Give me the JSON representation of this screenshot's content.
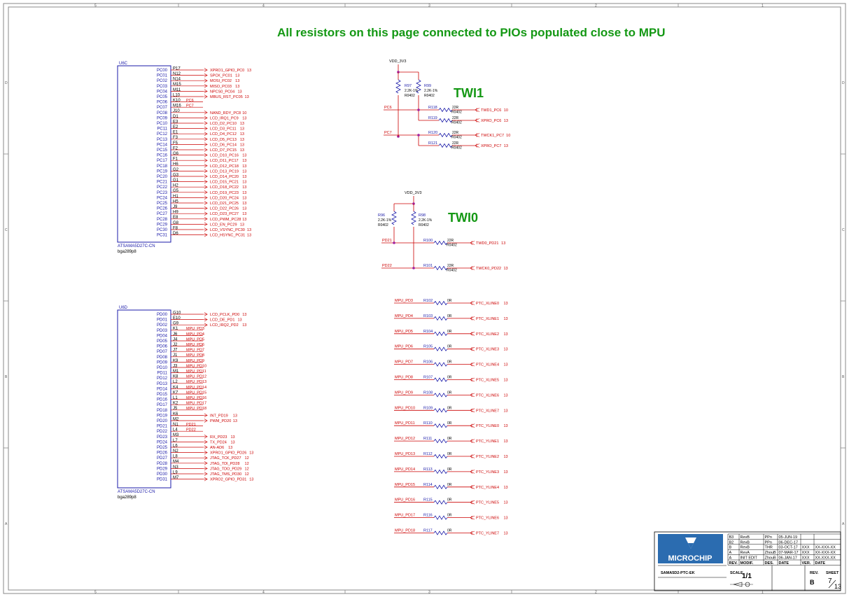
{
  "title": "All resistors  on this page connected to PIOs populated close to MPU",
  "zones_top": [
    "5",
    "4",
    "3",
    "2",
    "1"
  ],
  "zones_side": [
    "D",
    "C",
    "B",
    "A"
  ],
  "u6c": {
    "ref": "U6C",
    "part": "ATSAMA5D27C-CN",
    "package": "bga289p8",
    "pins": [
      {
        "pin": "PC00",
        "ball": "P17",
        "net": "XPRO1_GPIO_PC0",
        "page": "13"
      },
      {
        "pin": "PC01",
        "ball": "N12",
        "net": "SPCK_PC01",
        "page": "13"
      },
      {
        "pin": "PC02",
        "ball": "N14",
        "net": "MOSI_PC02",
        "page": "13"
      },
      {
        "pin": "PC03",
        "ball": "M15",
        "net": "MISO_PC03",
        "page": "13"
      },
      {
        "pin": "PC04",
        "ball": "M11",
        "net": "NPCS0_PC04",
        "page": "13"
      },
      {
        "pin": "PC05",
        "ball": "L10",
        "net": "MBUS_RST_PC05",
        "page": "13"
      },
      {
        "pin": "PC06",
        "ball": "K10",
        "net": "PC6",
        "page": ""
      },
      {
        "pin": "PC07",
        "ball": "M16",
        "net": "PC7",
        "page": ""
      },
      {
        "pin": "PC08",
        "ball": "J10",
        "net": "NAND_RDY_PC8",
        "page": "10"
      },
      {
        "pin": "PC09",
        "ball": "D1",
        "net": "LCD_IRQ1_PC9",
        "page": "13"
      },
      {
        "pin": "PC10",
        "ball": "E3",
        "net": "LCD_D2_PC10",
        "page": "13"
      },
      {
        "pin": "PC11",
        "ball": "E2",
        "net": "LCD_D3_PC11",
        "page": "13"
      },
      {
        "pin": "PC12",
        "ball": "E1",
        "net": "LCD_D4_PC12",
        "page": "13"
      },
      {
        "pin": "PC13",
        "ball": "F3",
        "net": "LCD_D5_PC13",
        "page": "13"
      },
      {
        "pin": "PC14",
        "ball": "F5",
        "net": "LCD_D6_PC14",
        "page": "13"
      },
      {
        "pin": "PC15",
        "ball": "F2",
        "net": "LCD_D7_PC15",
        "page": "13"
      },
      {
        "pin": "PC16",
        "ball": "G6",
        "net": "LCD_D10_PC16",
        "page": "13"
      },
      {
        "pin": "PC17",
        "ball": "F1",
        "net": "LCD_D11_PC17",
        "page": "13"
      },
      {
        "pin": "PC18",
        "ball": "H6",
        "net": "LCD_D12_PC18",
        "page": "13"
      },
      {
        "pin": "PC19",
        "ball": "G2",
        "net": "LCD_D13_PC19",
        "page": "13"
      },
      {
        "pin": "PC20",
        "ball": "G3",
        "net": "LCD_D14_PC20",
        "page": "13"
      },
      {
        "pin": "PC21",
        "ball": "G1",
        "net": "LCD_D15_PC21",
        "page": "13"
      },
      {
        "pin": "PC22",
        "ball": "H2",
        "net": "LCD_D18_PC22",
        "page": "13"
      },
      {
        "pin": "PC23",
        "ball": "G5",
        "net": "LCD_D19_PC23",
        "page": "13"
      },
      {
        "pin": "PC24",
        "ball": "H1",
        "net": "LCD_D20_PC24",
        "page": "13"
      },
      {
        "pin": "PC25",
        "ball": "H5",
        "net": "LCD_D21_PC25",
        "page": "13"
      },
      {
        "pin": "PC26",
        "ball": "J9",
        "net": "LCD_D22_PC26",
        "page": "13"
      },
      {
        "pin": "PC27",
        "ball": "H9",
        "net": "LCD_D23_PC27",
        "page": "13"
      },
      {
        "pin": "PC28",
        "ball": "E8",
        "net": "LCD_PWM_PC28",
        "page": "13"
      },
      {
        "pin": "PC29",
        "ball": "G8",
        "net": "LCD_EN_PC29",
        "page": "13"
      },
      {
        "pin": "PC30",
        "ball": "F8",
        "net": "LCD_VSYNC_PC30",
        "page": "13"
      },
      {
        "pin": "PC31",
        "ball": "D6",
        "net": "LCD_HSYNC_PC31",
        "page": "13"
      }
    ]
  },
  "u6d": {
    "ref": "U6D",
    "part": "ATSAMA5D27C-CN",
    "package": "bga289p8",
    "pins": [
      {
        "pin": "PD00",
        "ball": "G10",
        "net": "LCD_PCLK_PD0",
        "page": "13"
      },
      {
        "pin": "PD01",
        "ball": "E10",
        "net": "LCD_DE_PD1",
        "page": "13"
      },
      {
        "pin": "PD02",
        "ball": "G9",
        "net": "LCD_IRQ2_PD2",
        "page": "13"
      },
      {
        "pin": "PD03",
        "ball": "K1",
        "net": "MPU_PD3",
        "page": ""
      },
      {
        "pin": "PD04",
        "ball": "J6",
        "net": "MPU_PD4",
        "page": ""
      },
      {
        "pin": "PD05",
        "ball": "J4",
        "net": "MPU_PD5",
        "page": ""
      },
      {
        "pin": "PD06",
        "ball": "J2",
        "net": "MPU_PD6",
        "page": ""
      },
      {
        "pin": "PD07",
        "ball": "J7",
        "net": "MPU_PD7",
        "page": ""
      },
      {
        "pin": "PD08",
        "ball": "J1",
        "net": "MPU_PD8",
        "page": ""
      },
      {
        "pin": "PD09",
        "ball": "K9",
        "net": "MPU_PD9",
        "page": ""
      },
      {
        "pin": "PD10",
        "ball": "J3",
        "net": "MPU_PD10",
        "page": ""
      },
      {
        "pin": "PD11",
        "ball": "M1",
        "net": "MPU_PD11",
        "page": ""
      },
      {
        "pin": "PD12",
        "ball": "K8",
        "net": "MPU_PD12",
        "page": ""
      },
      {
        "pin": "PD13",
        "ball": "L2",
        "net": "MPU_PD13",
        "page": ""
      },
      {
        "pin": "PD14",
        "ball": "K4",
        "net": "MPU_PD14",
        "page": ""
      },
      {
        "pin": "PD15",
        "ball": "K7",
        "net": "MPU_PD15",
        "page": ""
      },
      {
        "pin": "PD16",
        "ball": "L1",
        "net": "MPU_PD16",
        "page": ""
      },
      {
        "pin": "PD17",
        "ball": "K2",
        "net": "MPU_PD17",
        "page": ""
      },
      {
        "pin": "PD18",
        "ball": "J5",
        "net": "MPU_PD18",
        "page": ""
      },
      {
        "pin": "PD19",
        "ball": "K6",
        "net": "INT_PD19",
        "page": "13"
      },
      {
        "pin": "PD20",
        "ball": "M2",
        "net": "PWM_PD20",
        "page": "13"
      },
      {
        "pin": "PD21",
        "ball": "N1",
        "net": "PD21",
        "page": ""
      },
      {
        "pin": "PD22",
        "ball": "L4",
        "net": "PD22",
        "page": ""
      },
      {
        "pin": "PD23",
        "ball": "M3",
        "net": "RX_PD23",
        "page": "13"
      },
      {
        "pin": "PD24",
        "ball": "L7",
        "net": "TX_PD24",
        "page": "13"
      },
      {
        "pin": "PD25",
        "ball": "L6",
        "net": "AN-AD6",
        "page": "13"
      },
      {
        "pin": "PD26",
        "ball": "N2",
        "net": "XPRO1_GPIO_PD26",
        "page": "13"
      },
      {
        "pin": "PD27",
        "ball": "L8",
        "net": "JTAG_TCK_PD27",
        "page": "12"
      },
      {
        "pin": "PD28",
        "ball": "M4",
        "net": "JTAG_TDI_PD28",
        "page": "12"
      },
      {
        "pin": "PD29",
        "ball": "N3",
        "net": "JTAG_TDO_PD29",
        "page": "12"
      },
      {
        "pin": "PD30",
        "ball": "L9",
        "net": "JTAG_TMS_PD30",
        "page": "12"
      },
      {
        "pin": "PD31",
        "ball": "M7",
        "net": "XPRO2_GPIO_PD31",
        "page": "13"
      }
    ]
  },
  "twi1": {
    "label": "TWI1",
    "supply": "VDD_3V3",
    "pullups": [
      {
        "ref": "R97",
        "value": "2.2K-1%",
        "pkg": "R0402"
      },
      {
        "ref": "R99",
        "value": "2.2K-1%",
        "pkg": "R0402"
      }
    ],
    "lines": [
      {
        "net_in": "PC6",
        "ref": "R118",
        "value": "22R",
        "pkg": "R0402",
        "net_out": "TWD1_PC6",
        "page": "10"
      },
      {
        "net_in": "",
        "ref": "R119",
        "value": "22R",
        "pkg": "R0402",
        "net_out": "XPRO_PC6",
        "page": "13"
      },
      {
        "net_in": "PC7",
        "ref": "R120",
        "value": "22R",
        "pkg": "R0402",
        "net_out": "TWCK1_PC7",
        "page": "10"
      },
      {
        "net_in": "",
        "ref": "R121",
        "value": "22R",
        "pkg": "R0402",
        "net_out": "XPRO_PC7",
        "page": "13"
      }
    ]
  },
  "twi0": {
    "label": "TWI0",
    "supply": "VDD_3V3",
    "pullups": [
      {
        "ref": "R96",
        "value": "2.2K-1%",
        "pkg": "R0402"
      },
      {
        "ref": "R98",
        "value": "2.2K-1%",
        "pkg": "R0402"
      }
    ],
    "lines": [
      {
        "net_in": "PD21",
        "ref": "R100",
        "value": "22R",
        "pkg": "R0402",
        "net_out": "TWD0_PD21",
        "page": "13"
      },
      {
        "net_in": "PD22",
        "ref": "R101",
        "value": "22R",
        "pkg": "R0402",
        "net_out": "TWCK0_PD22",
        "page": "13"
      }
    ]
  },
  "ptc": [
    {
      "net_in": "MPU_PD3",
      "ref": "R102",
      "value": "0R",
      "net_out": "PTC_XLINE0",
      "page": "13"
    },
    {
      "net_in": "MPU_PD4",
      "ref": "R103",
      "value": "0R",
      "net_out": "PTC_XLINE1",
      "page": "13"
    },
    {
      "net_in": "MPU_PD5",
      "ref": "R104",
      "value": "0R",
      "net_out": "PTC_XLINE2",
      "page": "13"
    },
    {
      "net_in": "MPU_PD6",
      "ref": "R105",
      "value": "0R",
      "net_out": "PTC_XLINE3",
      "page": "13"
    },
    {
      "net_in": "MPU_PD7",
      "ref": "R106",
      "value": "0R",
      "net_out": "PTC_XLINE4",
      "page": "13"
    },
    {
      "net_in": "MPU_PD8",
      "ref": "R107",
      "value": "0R",
      "net_out": "PTC_XLINE5",
      "page": "13"
    },
    {
      "net_in": "MPU_PD9",
      "ref": "R108",
      "value": "0R",
      "net_out": "PTC_XLINE6",
      "page": "13"
    },
    {
      "net_in": "MPU_PD10",
      "ref": "R109",
      "value": "0R",
      "net_out": "PTC_XLINE7",
      "page": "13"
    },
    {
      "net_in": "MPU_PD11",
      "ref": "R110",
      "value": "0R",
      "net_out": "PTC_YLINE0",
      "page": "13"
    },
    {
      "net_in": "MPU_PD12",
      "ref": "R111",
      "value": "0R",
      "net_out": "PTC_YLINE1",
      "page": "13"
    },
    {
      "net_in": "MPU_PD13",
      "ref": "R112",
      "value": "0R",
      "net_out": "PTC_YLINE2",
      "page": "13"
    },
    {
      "net_in": "MPU_PD14",
      "ref": "R113",
      "value": "0R",
      "net_out": "PTC_YLINE3",
      "page": "13"
    },
    {
      "net_in": "MPU_PD15",
      "ref": "R114",
      "value": "0R",
      "net_out": "PTC_YLINE4",
      "page": "13"
    },
    {
      "net_in": "MPU_PD16",
      "ref": "R115",
      "value": "0R",
      "net_out": "PTC_YLINE5",
      "page": "13"
    },
    {
      "net_in": "MPU_PD17",
      "ref": "R116",
      "value": "0R",
      "net_out": "PTC_YLINE6",
      "page": "13"
    },
    {
      "net_in": "MPU_PD18",
      "ref": "R117",
      "value": "0R",
      "net_out": "PTC_YLINE7",
      "page": "13"
    }
  ],
  "titleblock": {
    "logo": "MICROCHIP",
    "board": "SAMA5D2-PTC-EK",
    "scale_label": "SCALE",
    "scale": "1/1",
    "rev_label": "REV.",
    "rev": "B",
    "sheet_label": "SHEET",
    "sheet": "7",
    "sheet_total": "13",
    "brand_color": "#2b6cb0",
    "header": [
      "REV.",
      "MODIF.",
      "DES.",
      "DATE",
      "VER.",
      "DATE"
    ],
    "rows": [
      [
        "B3",
        "RevB",
        "PPn",
        "05-JUN-19",
        "",
        ""
      ],
      [
        "B2",
        "RevB",
        "PPn",
        "06-DEC-17",
        "",
        ""
      ],
      [
        "B",
        "RevB",
        "THR",
        "03-OCT-17",
        "XXX",
        "XX-XXX-XX"
      ],
      [
        "A",
        "RevA",
        "ZhouB",
        "07-MAR-17",
        "XXX",
        "XX-XXX-XX"
      ],
      [
        "A",
        "INIT EDIT",
        "ZhouB",
        "06-JAN-17",
        "XXX",
        "XX-XXX-XX"
      ]
    ]
  }
}
